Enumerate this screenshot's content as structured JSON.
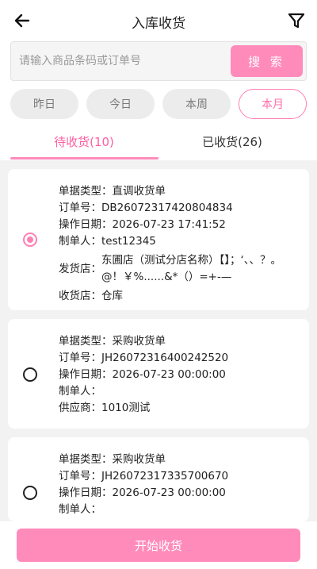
{
  "header": {
    "title": "入库收货",
    "back_icon": "arrow-left-icon",
    "filter_icon": "filter-icon"
  },
  "search": {
    "placeholder": "请输入商品条码或订单号",
    "value": "",
    "button_label": "搜 索"
  },
  "date_filters": [
    {
      "label": "昨日",
      "active": false
    },
    {
      "label": "今日",
      "active": false
    },
    {
      "label": "本周",
      "active": false
    },
    {
      "label": "本月",
      "active": true
    }
  ],
  "tabs": [
    {
      "label": "待收货(10)",
      "active": true
    },
    {
      "label": "已收货(26)",
      "active": false
    }
  ],
  "orders": [
    {
      "selected": true,
      "fields": [
        {
          "k": "单据类型：",
          "v": "直调收货单"
        },
        {
          "k": "订单号：",
          "v": "DB26072317420804834"
        },
        {
          "k": "操作日期：",
          "v": "2026-07-23 17:41:52"
        },
        {
          "k": "制单人：",
          "v": "test12345"
        },
        {
          "k": "发货店：",
          "v": "东圃店（测试分店名称）【】；‘、、？。@！￥%......&*（）=+-—"
        },
        {
          "k": "收货店：",
          "v": "仓库"
        }
      ]
    },
    {
      "selected": false,
      "fields": [
        {
          "k": "单据类型：",
          "v": "采购收货单"
        },
        {
          "k": "订单号：",
          "v": "JH26072316400242520"
        },
        {
          "k": "操作日期：",
          "v": "2026-07-23 00:00:00"
        },
        {
          "k": "制单人：",
          "v": ""
        },
        {
          "k": "供应商：",
          "v": "1010测试"
        }
      ]
    },
    {
      "selected": false,
      "fields": [
        {
          "k": "单据类型：",
          "v": "采购收货单"
        },
        {
          "k": "订单号：",
          "v": "JH26072317335700670"
        },
        {
          "k": "操作日期：",
          "v": "2026-07-23 00:00:00"
        },
        {
          "k": "制单人：",
          "v": ""
        }
      ]
    }
  ],
  "footer": {
    "start_label": "开始收货"
  },
  "colors": {
    "accent": "#ff8bbb",
    "accent_text": "#ff5fa2",
    "background": "#f2f2f2"
  }
}
